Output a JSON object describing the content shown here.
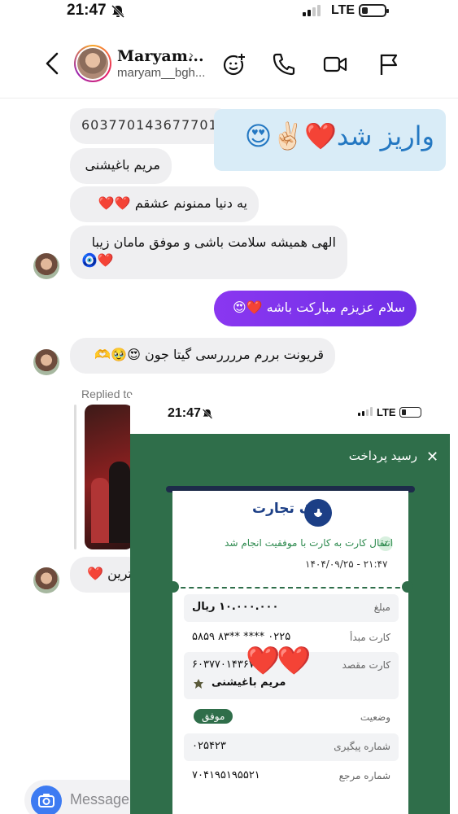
{
  "status_bar": {
    "time": "21:47",
    "network": "LTE",
    "signal_level": 0.5,
    "battery_level": 0.2
  },
  "header": {
    "name": "Maryam...",
    "username": "maryam__bgh...",
    "icons": [
      "back-icon",
      "chevron-right-icon",
      "add-emoji-icon",
      "phone-icon",
      "video-camera-icon",
      "flag-icon"
    ]
  },
  "messages": {
    "card_number_partial": "603770143677701",
    "story_text": "واریز شد❤️✌🏻😍",
    "m_name": "مریم باغیشنی",
    "m_thanks": "یه دنیا ممنونم عشقم",
    "m_thanks_hearts": "❤️❤️",
    "m_prayer_line1": "الهی همیشه سلامت باشی و موفق مامان زیبا",
    "m_prayer_line2": "🧿❤️",
    "m_sent": "سلام عزیزم مبارکت باشه",
    "m_sent_emoji": "❤️😍",
    "m_reply": "قریونت بررم مررررسی گیتا جون",
    "m_reply_emoji": "😍🥹🫶",
    "replied_label": "Replied to",
    "m_last": "ترین",
    "m_last_emoji": "❤️"
  },
  "composer": {
    "placeholder": "Message"
  },
  "receipt": {
    "time": "21:47",
    "network": "LTE",
    "title": "رسید پرداخت",
    "close": "✕",
    "bank_name": "بانک تجارت",
    "success_text": "انتقال کارت به کارت با موفقیت انجام شد",
    "datetime": "۱۴۰۴/۰۹/۲۵ - ۲۱:۴۷",
    "amount_label": "مبلغ",
    "amount_value": "۱۰.۰۰۰.۰۰۰ ریال",
    "source_label": "کارت مبدأ",
    "source_value": "۵۸۵۹ ۸۳** **** ۰۲۲۵",
    "dest_label": "کارت مقصد",
    "dest_value": "۶۰۳۷۷۰۱۴۳۶۷۷",
    "dest_name": "مریم باغیشنی",
    "status_label": "وضعیت",
    "status_value": "موفق",
    "tracking_label": "شماره پیگیری",
    "tracking_value": "۰۲۵۴۲۳",
    "reference_label": "شماره مرجع",
    "reference_value": "۷۰۴۱۹۵۱۹۵۵۲۱",
    "overlay_hearts": "❤️❤️"
  },
  "colors": {
    "accent_purple": "#7b33ec",
    "receipt_green": "#2f6e4a",
    "story_blue_bg": "#d9ecf7",
    "story_blue_text": "#2478c2"
  }
}
